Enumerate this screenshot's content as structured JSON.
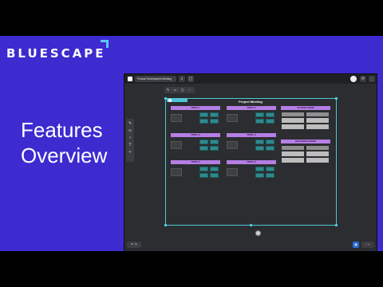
{
  "brand": {
    "name": "BLUESCAPE",
    "mark_icon": "corner-mark-icon",
    "accent": "#5ec8f2"
  },
  "headline": {
    "line1": "Features",
    "line2": "Overview"
  },
  "colors": {
    "stage": "#3d2bd0",
    "section": "#b57ee4",
    "teal": "#2e8a8f",
    "selection": "#4fc4d6"
  },
  "app": {
    "topbar": {
      "workspace_name": "Product Development Meeting",
      "buttons": [
        "search-icon",
        "share-icon"
      ],
      "right_buttons": [
        "avatar",
        "history-icon",
        "more-icon"
      ]
    },
    "board": {
      "title": "Project Meeting",
      "sections": [
        {
          "label": "TOPIC 1"
        },
        {
          "label": "TOPIC 2"
        },
        {
          "label": "TOPIC 3"
        },
        {
          "label": "TOPIC 4"
        },
        {
          "label": "TOPIC 5"
        },
        {
          "label": "TOPIC 6"
        },
        {
          "label": "ACTION ITEMS"
        },
        {
          "label": "DECISIONS MADE"
        }
      ]
    }
  }
}
